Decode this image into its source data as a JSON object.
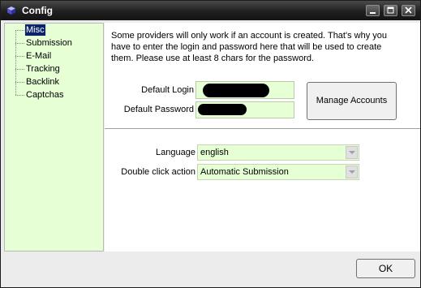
{
  "window": {
    "title": "Config"
  },
  "titlebar_buttons": {
    "minimize": "minimize-icon",
    "maximize": "maximize-icon",
    "close": "close-icon"
  },
  "tree": {
    "items": [
      {
        "label": "Misc",
        "selected": true
      },
      {
        "label": "Submission",
        "selected": false
      },
      {
        "label": "E-Mail",
        "selected": false
      },
      {
        "label": "Tracking",
        "selected": false
      },
      {
        "label": "Backlink",
        "selected": false
      },
      {
        "label": "Captchas",
        "selected": false
      }
    ]
  },
  "account": {
    "description": "Some providers will only work if an account is created. That's why you have to enter the login and password here that will be used to create them. Please use at least 8 chars for the password.",
    "login_label": "Default Login",
    "password_label": "Default Password",
    "manage_button": "Manage Accounts"
  },
  "settings": {
    "language_label": "Language",
    "language_value": "english",
    "double_click_label": "Double click action",
    "double_click_value": "Automatic Submission"
  },
  "footer": {
    "ok_button": "OK"
  },
  "colors": {
    "field_bg": "#e6ffd4",
    "titlebar": "#1f1f1f",
    "selection": "#0a246a"
  }
}
